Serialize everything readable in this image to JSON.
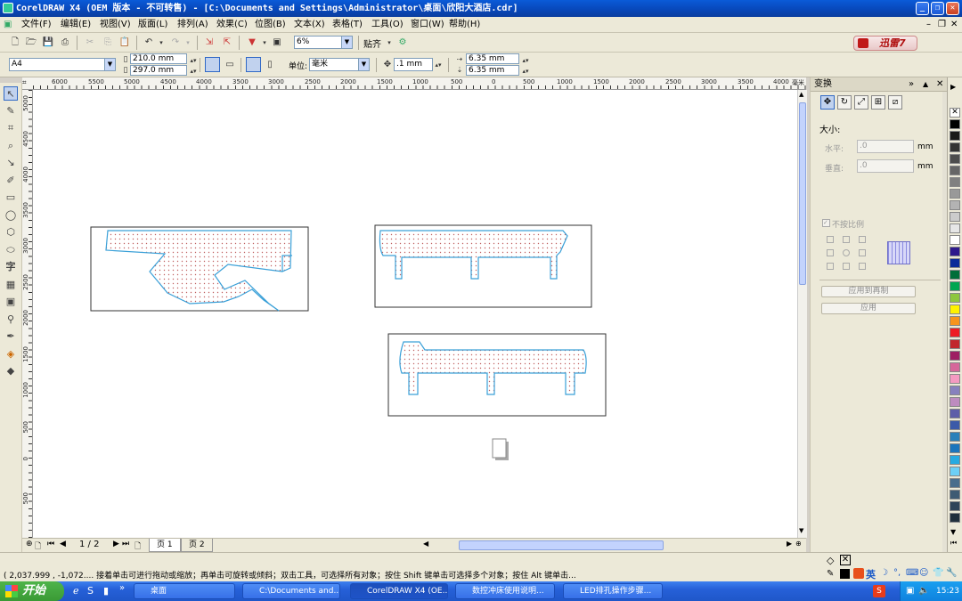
{
  "window": {
    "title": "CorelDRAW X4 (OEM 版本 - 不可转售) - [C:\\Documents and Settings\\Administrator\\桌面\\欣阳大酒店.cdr]",
    "minimize": "_",
    "maximize": "❐",
    "close": "✕"
  },
  "menu": {
    "items": [
      "文件(F)",
      "编辑(E)",
      "视图(V)",
      "版面(L)",
      "排列(A)",
      "效果(C)",
      "位图(B)",
      "文本(X)",
      "表格(T)",
      "工具(O)",
      "窗口(W)",
      "帮助(H)"
    ],
    "doc_controls": [
      "–",
      "❐",
      "✕"
    ]
  },
  "toolbar1": {
    "zoom": "6%",
    "snap_label": "贴齐",
    "brand": "迅雷7"
  },
  "propertybar": {
    "page_size": "A4",
    "width": "210.0 mm",
    "height": "297.0 mm",
    "unit_label": "单位:",
    "unit": "毫米",
    "nudge": ".1 mm",
    "dup_x": "6.35 mm",
    "dup_y": "6.35 mm"
  },
  "hruler": {
    "ticks": [
      "6000",
      "5500",
      "5000",
      "4500",
      "4000",
      "3500",
      "3000",
      "2500",
      "2000",
      "1500",
      "1000",
      "500",
      "0",
      "500",
      "1000",
      "1500",
      "2000",
      "2500",
      "3000",
      "3500",
      "4000"
    ],
    "unit": "毫米"
  },
  "vruler": {
    "ticks": [
      "5000",
      "4500",
      "4000",
      "3500",
      "3000",
      "2500",
      "2000",
      "1500",
      "1000",
      "500",
      "0",
      "500"
    ]
  },
  "pages": {
    "counter": "1 / 2",
    "tabs": [
      "页 1",
      "页 2"
    ]
  },
  "docker": {
    "title": "变换",
    "size_label": "大小:",
    "h_label": "水平:",
    "v_label": "垂直:",
    "h_value": ".0",
    "v_value": ".0",
    "unit": "mm",
    "proportional_label": "不按比例",
    "apply_dup_label": "应用到再制",
    "apply_label": "应用"
  },
  "palette": {
    "colors": [
      "#000000",
      "#1a1a1a",
      "#333333",
      "#4d4d4d",
      "#666666",
      "#808080",
      "#999999",
      "#b3b3b3",
      "#cccccc",
      "#e6e6e6",
      "#ffffff",
      "#2e1a8c",
      "#0a2a99",
      "#006e3a",
      "#00a651",
      "#8dc63f",
      "#fff200",
      "#f7941d",
      "#ed1c24",
      "#c1272d",
      "#9e1f63",
      "#d6679a",
      "#f49ac1",
      "#8781bd",
      "#bd8cbf",
      "#5e5ea8",
      "#3c5aa8",
      "#2980b9",
      "#1c75bc",
      "#27aae1",
      "#6dcff6",
      "#4a6d8c",
      "#3e5a73",
      "#2f4459",
      "#202f3d"
    ]
  },
  "status": {
    "text": "( 2,037.999 , -1,072.... 接着单击可进行拖动或缩放；再单击可旋转或倾斜；双击工具，可选择所有对象；按住 Shift 键单击可选择多个对象；按住 Alt 键单击..."
  },
  "taskbar": {
    "start": "开始",
    "tasks": [
      "桌面",
      "C:\\Documents and...",
      "CorelDRAW X4 (OE...",
      "数控冲床使用说明...",
      "LED排孔操作步骤..."
    ],
    "clock": "15:23",
    "ime": "英"
  }
}
